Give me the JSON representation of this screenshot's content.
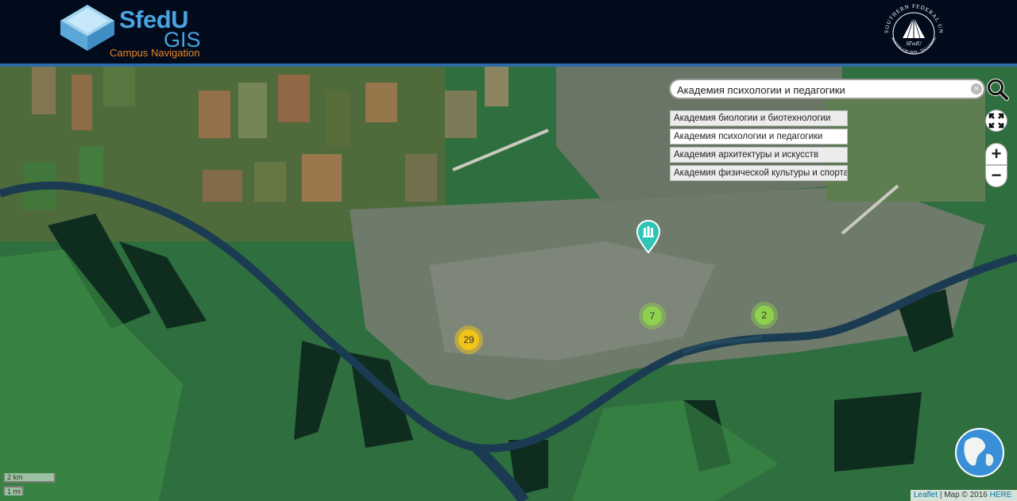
{
  "header": {
    "logo_primary": "SfedU",
    "logo_secondary": "GIS",
    "logo_subtitle": "Campus Navigation",
    "seal_top_text": "SOUTHERN FEDERAL UNIVERSITY",
    "seal_center_text": "SFedU",
    "seal_bottom_text": "ROSTOV-ON-DON · TAGANROG"
  },
  "search": {
    "value": "Академия психологии и педагогики",
    "clear_glyph": "×"
  },
  "suggestions": [
    {
      "label": "Академия биологии и биотехнологии",
      "active": false
    },
    {
      "label": "Академия психологии и педагогики",
      "active": true
    },
    {
      "label": "Академия архитектуры и искусств",
      "active": false
    },
    {
      "label": "Академия физической культуры и спорта",
      "active": false
    }
  ],
  "controls": {
    "fullscreen_icon": "fullscreen-icon",
    "zoom_in_label": "+",
    "zoom_out_label": "−"
  },
  "clusters": [
    {
      "id": "cluster-29",
      "count": "29",
      "color": "#f0c419"
    },
    {
      "id": "cluster-7",
      "count": "7",
      "color": "#8fd14f"
    },
    {
      "id": "cluster-2",
      "count": "2",
      "color": "#8fd14f"
    }
  ],
  "pin": {
    "color": "#2ec4b6",
    "icon": "library-icon"
  },
  "scale": {
    "km_label": "2 km",
    "mi_label": "1 mi"
  },
  "attribution": {
    "leaflet": "Leaflet",
    "rest": "| Map © 2016",
    "here": "HERE"
  },
  "colors": {
    "header_bg": "#010b1c",
    "accent_blue": "#4aa3e0",
    "accent_orange": "#e8842a",
    "river": "#1b3b52"
  }
}
